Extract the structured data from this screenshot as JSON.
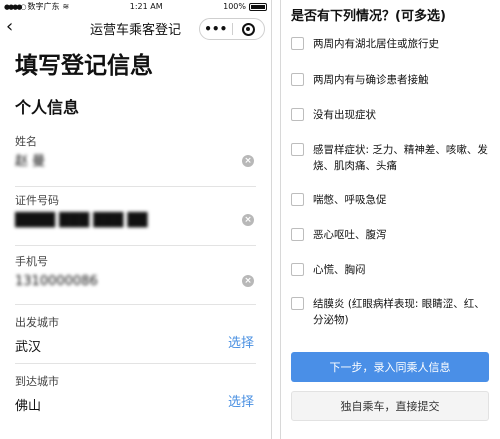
{
  "status_bar": {
    "carrier": "数字广东",
    "time": "1:21 AM",
    "battery": "100%"
  },
  "nav": {
    "title": "运营车乘客登记",
    "more_label": "•••"
  },
  "form": {
    "page_title": "填写登记信息",
    "section_title": "个人信息",
    "name": {
      "label": "姓名",
      "value": "赵 曼"
    },
    "id_number": {
      "label": "证件号码",
      "value": "████ ███ ███ ██"
    },
    "phone": {
      "label": "手机号",
      "value": "1310000086"
    },
    "departure_city": {
      "label": "出发城市",
      "value": "武汉",
      "action": "选择"
    },
    "arrival_city": {
      "label": "到达城市",
      "value": "佛山",
      "action": "选择"
    }
  },
  "symptoms": {
    "question": "是否有下列情况？(可多选)",
    "options": [
      {
        "label": "两周内有湖北居住或旅行史",
        "checked": false
      },
      {
        "label": "两周内有与确诊患者接触",
        "checked": false
      },
      {
        "label": "没有出现症状",
        "checked": false
      },
      {
        "label": "感冒样症状: 乏力、精神差、咳嗽、发烧、肌肉痛、头痛",
        "checked": false
      },
      {
        "label": "喘憋、呼吸急促",
        "checked": false
      },
      {
        "label": "恶心呕吐、腹泻",
        "checked": false
      },
      {
        "label": "心慌、胸闷",
        "checked": false
      },
      {
        "label": "结膜炎 (红眼病样表现: 眼睛涩、红、分泌物)",
        "checked": false
      }
    ]
  },
  "actions": {
    "next_label": "下一步，录入同乘人信息",
    "submit_alone_label": "独自乘车，直接提交"
  },
  "colors": {
    "accent": "#4a8fe7",
    "link": "#4a90e2"
  }
}
